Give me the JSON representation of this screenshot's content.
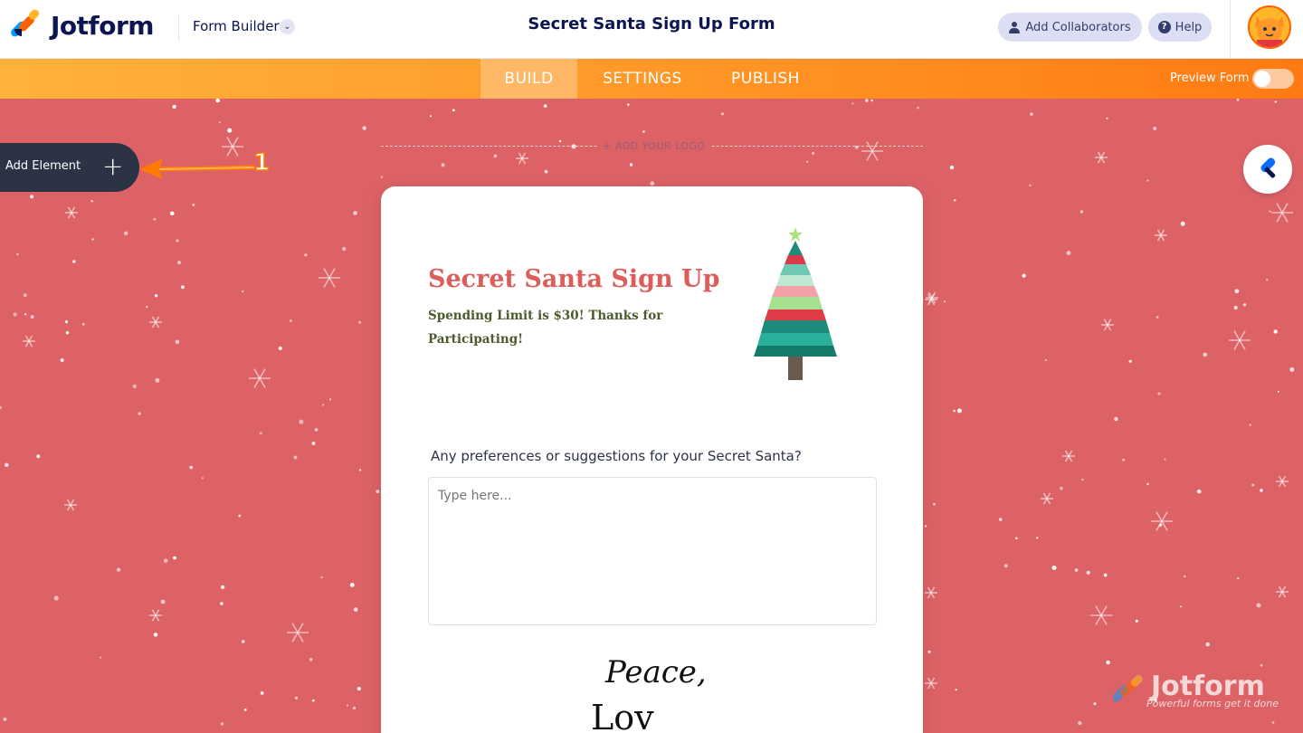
{
  "header": {
    "brand": "Jotform",
    "section_label": "Form Builder",
    "form_title": "Secret Santa Sign Up Form",
    "collaborators_label": "Add Collaborators",
    "help_label": "Help"
  },
  "nav": {
    "tabs": [
      {
        "label": "BUILD",
        "active": true
      },
      {
        "label": "SETTINGS",
        "active": false
      },
      {
        "label": "PUBLISH",
        "active": false
      }
    ],
    "preview_label": "Preview Form",
    "preview_enabled": false
  },
  "builder": {
    "add_element_label": "Add Element",
    "annotation_number": "1",
    "logo_placeholder": "+ ADD YOUR LOGO"
  },
  "form": {
    "heading": "Secret Santa Sign Up",
    "subheading": "Spending Limit is $30! Thanks for Participating!",
    "question_label": "Any preferences or suggestions for your Secret Santa?",
    "textarea_placeholder": "Type here...",
    "image_text_line1": "Peace,",
    "image_text_line2": "Lov"
  },
  "watermark": {
    "name": "Jotform",
    "tagline": "Powerful forms get it done"
  },
  "colors": {
    "canvas_bg": "#dc6266",
    "heading": "#dc5d5a",
    "subheading": "#4c5a2c",
    "brand_navy": "#0a1551",
    "nav_orange_start": "#ffb23a",
    "nav_orange_end": "#ff7a12"
  }
}
